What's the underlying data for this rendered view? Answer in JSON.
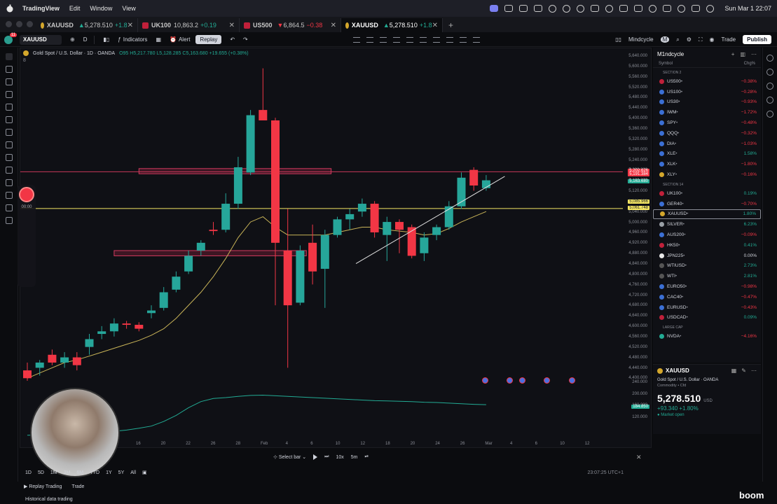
{
  "menubar": {
    "app_name": "TradingView",
    "menus": [
      "Edit",
      "Window",
      "View"
    ],
    "clock": "Sun Mar 1  22:07"
  },
  "tabs": [
    {
      "symbol": "XAUUSD",
      "price": "5,278.510",
      "change": "+1.8",
      "dir": "up",
      "icon": "gold-coin-icon"
    },
    {
      "symbol": "UK100",
      "price": "10,863.2",
      "change": "+0.19",
      "dir": "up",
      "icon": "flag-icon"
    },
    {
      "symbol": "US500",
      "price": "6,864.5",
      "change": "−0.38",
      "dir": "down",
      "icon": "flag-icon"
    },
    {
      "symbol": "XAUUSD",
      "price": "5,278.510",
      "change": "+1.8",
      "dir": "up",
      "icon": "gold-coin-icon"
    }
  ],
  "toolbar": {
    "symbol": "XAUUSD",
    "interval": "D",
    "indicators": "Indicators",
    "alert": "Alert",
    "replay": "Replay",
    "layout_name": "Mindcycle",
    "layout_initial": "M",
    "trade": "Trade",
    "publish": "Publish",
    "avatar_initial": "M",
    "notif_count": "11"
  },
  "chart": {
    "legend_title": "Gold Spot / U.S. Dollar · 1D · OANDA",
    "legend_ohlc": "O95 H5,217.780 L5,128.285 C5,163.680 +19.655 (+0.38%)",
    "legend_sub": "8",
    "y_ticks": [
      "5,640.000",
      "5,600.000",
      "5,560.000",
      "5,520.000",
      "5,480.000",
      "5,440.000",
      "5,400.000",
      "5,360.000",
      "5,320.000",
      "5,280.000",
      "5,240.000",
      "5,200.000",
      "5,160.000",
      "5,120.000",
      "5,080.000",
      "5,040.000",
      "5,000.000",
      "4,960.000",
      "4,920.000",
      "4,880.000",
      "4,840.000",
      "4,800.000",
      "4,760.000",
      "4,720.000",
      "4,680.000",
      "4,640.000",
      "4,600.000",
      "4,560.000",
      "4,520.000",
      "4,480.000",
      "4,440.000",
      "4,400.000"
    ],
    "y_badges": [
      {
        "label": "5,202.626",
        "color": "#f23645"
      },
      {
        "label": "5,191.384",
        "color": "#f23645"
      },
      {
        "label": "5,163.680",
        "color": "#22ab94"
      },
      {
        "label": "5,085.966",
        "color": "#f5e663"
      },
      {
        "label": "5,061.748",
        "color": "#f5e663"
      }
    ],
    "osc_ticks": [
      "240.000",
      "200.000",
      "160.000",
      "120.000"
    ],
    "osc_badge": "184.850",
    "x_ticks": [
      "16",
      "20",
      "22",
      "26",
      "28",
      "Feb",
      "4",
      "6",
      "10",
      "12",
      "18",
      "20",
      "24",
      "26",
      "Mar",
      "4",
      "6",
      "10",
      "12"
    ]
  },
  "chart_data": {
    "type": "candlestick",
    "title": "Gold Spot / U.S. Dollar · 1D · OANDA",
    "ylim": [
      4400,
      5650
    ],
    "candles": [
      {
        "o": 4440,
        "h": 4470,
        "l": 4400,
        "c": 4410
      },
      {
        "o": 4450,
        "h": 4480,
        "l": 4420,
        "c": 4470
      },
      {
        "o": 4500,
        "h": 4520,
        "l": 4460,
        "c": 4470
      },
      {
        "o": 4470,
        "h": 4510,
        "l": 4450,
        "c": 4490
      },
      {
        "o": 4490,
        "h": 4510,
        "l": 4440,
        "c": 4460
      },
      {
        "o": 4530,
        "h": 4580,
        "l": 4500,
        "c": 4560
      },
      {
        "o": 4580,
        "h": 4610,
        "l": 4560,
        "c": 4590
      },
      {
        "o": 4590,
        "h": 4640,
        "l": 4570,
        "c": 4620
      },
      {
        "o": 4620,
        "h": 4630,
        "l": 4600,
        "c": 4615
      },
      {
        "o": 4615,
        "h": 4625,
        "l": 4590,
        "c": 4600
      },
      {
        "o": 4660,
        "h": 4690,
        "l": 4640,
        "c": 4670
      },
      {
        "o": 4680,
        "h": 4760,
        "l": 4670,
        "c": 4740
      },
      {
        "o": 4750,
        "h": 4820,
        "l": 4740,
        "c": 4800
      },
      {
        "o": 4820,
        "h": 4900,
        "l": 4810,
        "c": 4880
      },
      {
        "o": 4900,
        "h": 4940,
        "l": 4880,
        "c": 4930
      },
      {
        "o": 4980,
        "h": 5010,
        "l": 4960,
        "c": 4975
      },
      {
        "o": 4980,
        "h": 5120,
        "l": 4970,
        "c": 5080
      },
      {
        "o": 5080,
        "h": 5260,
        "l": 5060,
        "c": 5220
      },
      {
        "o": 5200,
        "h": 5440,
        "l": 5190,
        "c": 5420
      },
      {
        "o": 5440,
        "h": 5600,
        "l": 5400,
        "c": 5400
      },
      {
        "o": 5400,
        "h": 5410,
        "l": 4690,
        "c": 4930
      },
      {
        "o": 4900,
        "h": 5060,
        "l": 4450,
        "c": 4690
      },
      {
        "o": 4700,
        "h": 4920,
        "l": 4690,
        "c": 4900
      },
      {
        "o": 4930,
        "h": 5000,
        "l": 4770,
        "c": 4820
      },
      {
        "o": 4830,
        "h": 4980,
        "l": 4680,
        "c": 4960
      },
      {
        "o": 4960,
        "h": 5030,
        "l": 4950,
        "c": 5020
      },
      {
        "o": 5020,
        "h": 5060,
        "l": 4980,
        "c": 5040
      },
      {
        "o": 5050,
        "h": 5100,
        "l": 5030,
        "c": 5080
      },
      {
        "o": 5080,
        "h": 5090,
        "l": 4950,
        "c": 4970
      },
      {
        "o": 4960,
        "h": 5030,
        "l": 4860,
        "c": 5010
      },
      {
        "o": 5010,
        "h": 5020,
        "l": 4890,
        "c": 4980
      },
      {
        "o": 4990,
        "h": 5000,
        "l": 4870,
        "c": 4880
      },
      {
        "o": 4890,
        "h": 4970,
        "l": 4860,
        "c": 4950
      },
      {
        "o": 4960,
        "h": 5000,
        "l": 4940,
        "c": 4990
      },
      {
        "o": 4990,
        "h": 5090,
        "l": 4980,
        "c": 5070
      },
      {
        "o": 5070,
        "h": 5200,
        "l": 5060,
        "c": 5180
      },
      {
        "o": 5210,
        "h": 5220,
        "l": 5130,
        "c": 5150
      },
      {
        "o": 5140,
        "h": 5190,
        "l": 5130,
        "c": 5170
      }
    ],
    "ma": [
      4410,
      4430,
      4450,
      4470,
      4480,
      4495,
      4510,
      4525,
      4540,
      4555,
      4575,
      4600,
      4640,
      4690,
      4740,
      4800,
      4870,
      4950,
      5010,
      5030,
      4990,
      4960,
      4960,
      4960,
      4960,
      4970,
      4980,
      4990,
      4990,
      4980,
      4975,
      4970,
      4960,
      4965,
      4985,
      5010,
      5030,
      5050
    ],
    "h_lines": [
      {
        "y": 5202.6,
        "color": "#c8385a"
      },
      {
        "y": 5061.7,
        "color": "#f5e663"
      }
    ],
    "zones": [
      {
        "x0": 9,
        "x1": 24.5,
        "y0": 5195,
        "y1": 5215
      },
      {
        "x0": 7,
        "x1": 22.5,
        "y0": 4880,
        "y1": 4900
      }
    ],
    "trendline": [
      {
        "i": 26.5,
        "y": 4850
      },
      {
        "i": 38.5,
        "y": 5185
      }
    ],
    "osc": [
      95,
      96,
      97,
      98,
      100,
      102,
      105,
      108,
      112,
      118,
      125,
      140,
      160,
      185,
      205,
      215,
      218,
      222,
      225,
      226,
      224,
      222,
      220,
      218,
      216,
      214,
      212,
      210,
      208,
      207,
      206,
      205,
      203,
      202,
      200,
      198,
      196,
      195
    ]
  },
  "watchlist": {
    "name": "M1ndcycle",
    "col_symbol": "Symbol",
    "col_chg": "Chg%",
    "groups": [
      {
        "title": "SECTION 2",
        "items": [
          {
            "sym": "US500",
            "chg": "−0.38%",
            "cls": "neg",
            "color": "#c0203a"
          },
          {
            "sym": "US100",
            "chg": "−0.28%",
            "cls": "neg",
            "color": "#3b6fd4"
          },
          {
            "sym": "US30",
            "chg": "−0.93%",
            "cls": "neg",
            "color": "#3b6fd4"
          },
          {
            "sym": "IWM",
            "chg": "−1.72%",
            "cls": "neg",
            "color": "#3b6fd4"
          },
          {
            "sym": "SPY",
            "chg": "−0.48%",
            "cls": "neg",
            "color": "#3b6fd4"
          },
          {
            "sym": "QQQ",
            "chg": "−0.32%",
            "cls": "neg",
            "color": "#3b6fd4"
          },
          {
            "sym": "DIA",
            "chg": "−1.03%",
            "cls": "neg",
            "color": "#3b6fd4"
          },
          {
            "sym": "XLE",
            "chg": "1.58%",
            "cls": "pos",
            "color": "#3b6fd4"
          },
          {
            "sym": "XLK",
            "chg": "−1.80%",
            "cls": "neg",
            "color": "#3b6fd4"
          },
          {
            "sym": "XLY",
            "chg": "−0.16%",
            "cls": "neg",
            "color": "#d4a72c"
          }
        ]
      },
      {
        "title": "SECTION 14",
        "items": [
          {
            "sym": "UK100",
            "chg": "0.19%",
            "cls": "pos",
            "color": "#c0203a"
          },
          {
            "sym": "GER40",
            "chg": "−0.70%",
            "cls": "neg",
            "color": "#3b6fd4"
          },
          {
            "sym": "XAUUSD",
            "chg": "1.80%",
            "cls": "pos",
            "color": "#d4a72c",
            "selected": true
          },
          {
            "sym": "SILVER",
            "chg": "6.23%",
            "cls": "pos",
            "color": "#9aa0a6"
          },
          {
            "sym": "AUS200",
            "chg": "−0.09%",
            "cls": "neg",
            "color": "#3b6fd4"
          },
          {
            "sym": "HK50",
            "chg": "0.41%",
            "cls": "pos",
            "color": "#c0203a"
          },
          {
            "sym": "JPN225",
            "chg": "0.00%",
            "cls": "neu",
            "color": "#e8e8e8"
          },
          {
            "sym": "WTIUSD",
            "chg": "2.73%",
            "cls": "pos",
            "color": "#555"
          },
          {
            "sym": "WTI",
            "chg": "2.81%",
            "cls": "pos",
            "color": "#555"
          },
          {
            "sym": "EURO50",
            "chg": "−0.98%",
            "cls": "neg",
            "color": "#3b6fd4"
          },
          {
            "sym": "CAC40",
            "chg": "−0.47%",
            "cls": "neg",
            "color": "#3b6fd4"
          },
          {
            "sym": "EURUSD",
            "chg": "−0.43%",
            "cls": "neg",
            "color": "#3b6fd4"
          },
          {
            "sym": "USDCAD",
            "chg": "0.09%",
            "cls": "pos",
            "color": "#c0203a"
          }
        ]
      },
      {
        "title": "LARGE CAP",
        "items": [
          {
            "sym": "NVDA",
            "chg": "−4.16%",
            "cls": "neg",
            "color": "#22ab94"
          }
        ]
      }
    ]
  },
  "detail": {
    "symbol": "XAUUSD",
    "name": "Gold Spot / U.S. Dollar · OANDA",
    "type": "Commodity • Cfd",
    "price": "5,278.510",
    "currency": "USD",
    "change": "+93.340  +1.80%",
    "market": "● Market open"
  },
  "replay": {
    "select_bar": "Select bar",
    "speed": "10x",
    "interval": "5m",
    "rec_time": "00:00"
  },
  "timebar": {
    "ranges": [
      "1D",
      "5D",
      "1M",
      "3M",
      "6M",
      "YTD",
      "1Y",
      "5Y",
      "All"
    ],
    "clock": "23:07:25 UTC+1"
  },
  "bottom_tabs": [
    "Replay Trading",
    "Trade"
  ],
  "historical": "Historical data trading",
  "watermark": "boom"
}
